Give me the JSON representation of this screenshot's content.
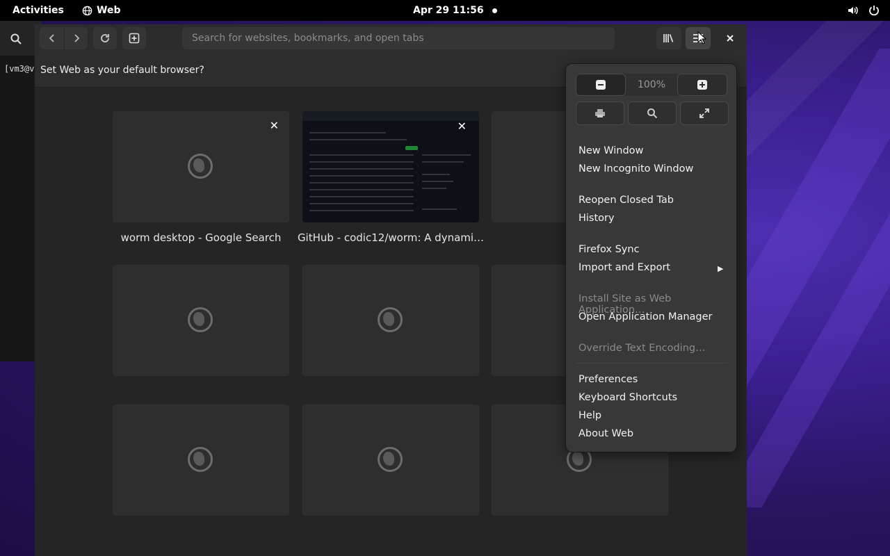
{
  "topbar": {
    "activities": "Activities",
    "app_name": "Web",
    "clock": "Apr 29  11:56"
  },
  "terminal": {
    "prompt": "[vm3@v"
  },
  "browser": {
    "search_placeholder": "Search for websites, bookmarks, and open tabs",
    "infobar_text": "Set Web as your default browser?"
  },
  "tiles": [
    {
      "label": "worm desktop - Google Search"
    },
    {
      "label": "GitHub - codic12/worm: A dynami…"
    }
  ],
  "menu": {
    "zoom_level": "100%",
    "items": [
      {
        "label": "New Window"
      },
      {
        "label": "New Incognito Window"
      },
      {
        "label": "Reopen Closed Tab"
      },
      {
        "label": "History"
      },
      {
        "label": "Firefox Sync"
      },
      {
        "label": "Import and Export"
      },
      {
        "label": "Install Site as Web Application…"
      },
      {
        "label": "Open Application Manager"
      },
      {
        "label": "Override Text Encoding…"
      },
      {
        "label": "Preferences"
      },
      {
        "label": "Keyboard Shortcuts"
      },
      {
        "label": "Help"
      },
      {
        "label": "About Web"
      }
    ]
  },
  "colors": {
    "topbar": "#000000",
    "window_bg": "#242424",
    "popover_bg": "#383838",
    "wallpaper_accent": "#4b2fb0"
  }
}
